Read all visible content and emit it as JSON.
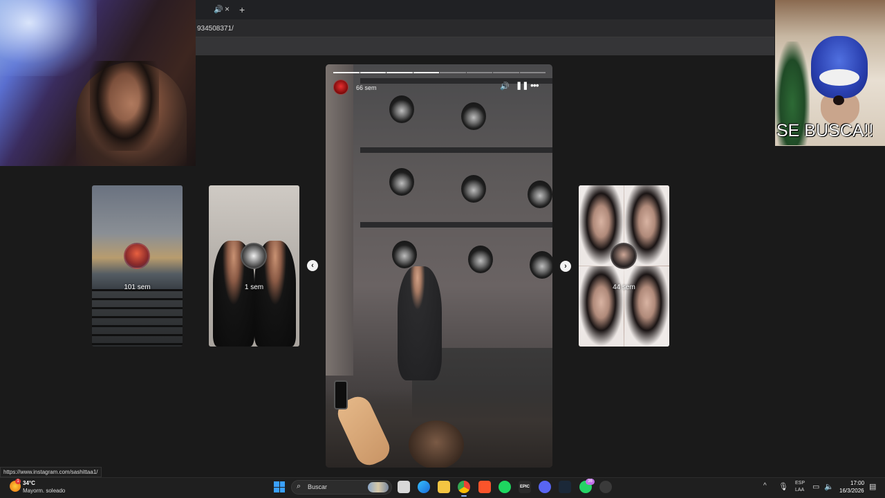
{
  "browser": {
    "url": "934508371/",
    "new_tab_symbol": "+",
    "tab_audio_icon": "speaker-icon",
    "tab_close_icon": "close-icon",
    "tab_close_symbol": "×"
  },
  "webcams": {
    "right_caption": "SE BUSCA!!"
  },
  "stories": {
    "cards": [
      {
        "time": "101 sem"
      },
      {
        "time": "1 sem"
      },
      {
        "time": "44 sem"
      }
    ],
    "current": {
      "time": "66 sem",
      "progress_segments": 8,
      "progress_done": 4
    },
    "prev_symbol": "‹",
    "next_symbol": "›"
  },
  "status_bar": {
    "link": "https://www.instagram.com/sashittaa1/"
  },
  "taskbar": {
    "weather_temp": "34°C",
    "weather_desc": "Mayorm. soleado",
    "weather_badge": "1",
    "search_label": "Buscar",
    "apps": [
      {
        "icon": "file-explorer-icon",
        "label": ""
      },
      {
        "icon": "edge-icon",
        "label": ""
      },
      {
        "icon": "folder-icon",
        "label": ""
      },
      {
        "icon": "chrome-icon",
        "label": ""
      },
      {
        "icon": "brave-icon",
        "label": ""
      },
      {
        "icon": "spotify-icon",
        "label": ""
      },
      {
        "icon": "epic-games-icon",
        "label": "EPIC"
      },
      {
        "icon": "discord-icon",
        "label": ""
      },
      {
        "icon": "steam-icon",
        "label": ""
      },
      {
        "icon": "whatsapp-icon",
        "label": ""
      },
      {
        "icon": "whatsapp-badge",
        "label": "36"
      },
      {
        "icon": "obs-icon",
        "label": ""
      }
    ],
    "lang_line1": "ESP",
    "lang_line2": "LAA",
    "time": "17:00",
    "date": "16/3/2026"
  },
  "colors": {
    "taskbar_bg": "#1f1f1f",
    "page_bg": "#1a1a1a",
    "windows_blue": "#3aa0ff"
  }
}
